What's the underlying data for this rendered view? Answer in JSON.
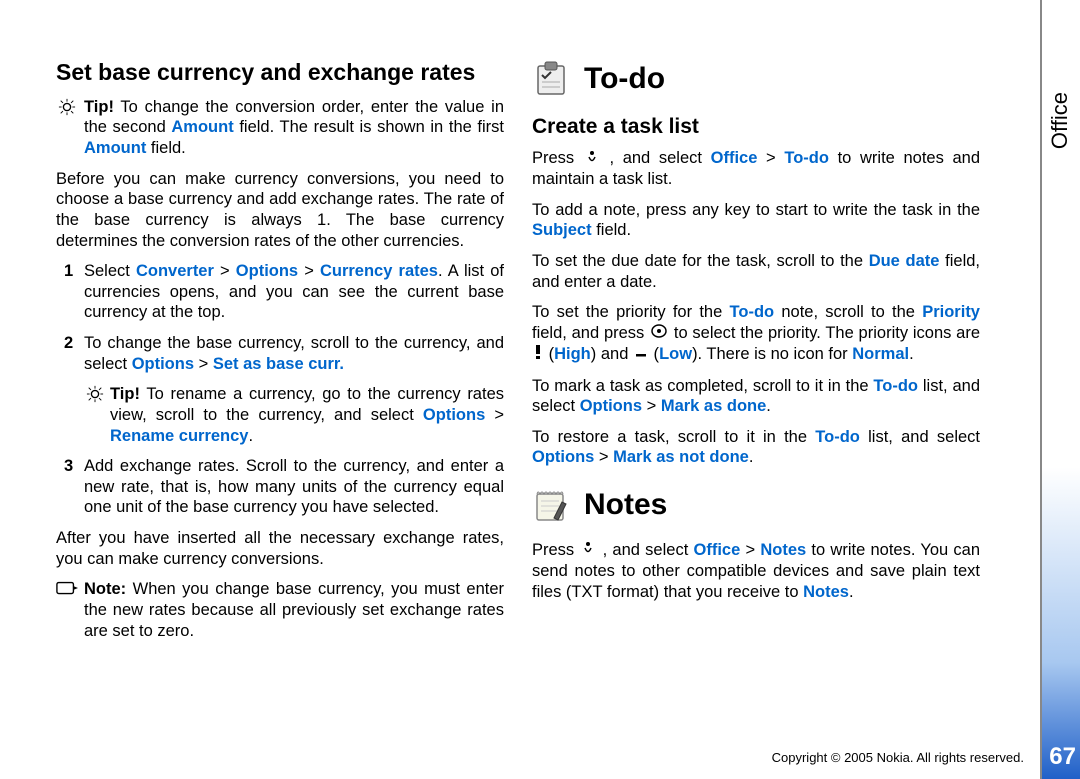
{
  "side_tab": "Office",
  "page_number": "67",
  "copyright": "Copyright © 2005 Nokia. All rights reserved.",
  "left": {
    "heading": "Set base currency and exchange rates",
    "tip1_label": "Tip!",
    "tip1_a": " To change the conversion order, enter the value in the second ",
    "tip1_amount1": "Amount",
    "tip1_b": " field. The result is shown in the first ",
    "tip1_amount2": "Amount",
    "tip1_c": " field.",
    "para1": "Before you can make currency conversions, you need to choose a base currency and add exchange rates. The rate of the base currency is always 1. The base currency determines the conversion rates of the other currencies.",
    "step1_a": "Select ",
    "step1_conv": "Converter",
    "step1_gt1": " > ",
    "step1_opt": "Options",
    "step1_gt2": " > ",
    "step1_cr": "Currency rates",
    "step1_b": ". A list of currencies opens, and you can see the current base currency at the top.",
    "step2_a": "To change the base currency, scroll to the currency, and select ",
    "step2_opt": "Options",
    "step2_gt": " > ",
    "step2_set": "Set as base curr.",
    "tip2_label": "Tip!",
    "tip2_a": " To rename a currency, go to the currency rates view, scroll to the currency, and select ",
    "tip2_opt": "Options",
    "tip2_gt": " > ",
    "tip2_ren": "Rename currency",
    "tip2_dot": ".",
    "step3": "Add exchange rates. Scroll to the currency, and enter a new rate, that is, how many units of the currency equal one unit of the base currency you have selected.",
    "para2": "After you have inserted all the necessary exchange rates, you can make currency conversions.",
    "note_label": "Note:",
    "note_text": " When you change base currency, you must enter the new rates because all previously set exchange rates are set to zero."
  },
  "right": {
    "todo_title": "To-do",
    "h3": "Create a task list",
    "p1_a": "Press ",
    "p1_b": " , and select ",
    "p1_office": "Office",
    "p1_gt": " > ",
    "p1_todo": "To-do",
    "p1_c": " to write notes and maintain a task list.",
    "p2_a": "To add a note, press any key to start to write the task in the ",
    "p2_subject": "Subject",
    "p2_b": " field.",
    "p3_a": "To set the due date for the task, scroll to the ",
    "p3_due": "Due date",
    "p3_b": " field, and enter a date.",
    "p4_a": "To set the priority for the ",
    "p4_todo1": "To-do",
    "p4_b": " note, scroll to the ",
    "p4_prio": "Priority",
    "p4_c": " field, and press ",
    "p4_d": " to select the priority. The priority icons are ",
    "p4_high": "High",
    "p4_e": ") and ",
    "p4_low": "Low",
    "p4_f": "). There is no icon for ",
    "p4_normal": "Normal",
    "p4_g": ".",
    "p5_a": "To mark a task as completed, scroll to it in the ",
    "p5_todo": "To-do",
    "p5_b": " list, and select ",
    "p5_opt": "Options",
    "p5_gt": " > ",
    "p5_mark": "Mark as done",
    "p5_dot": ".",
    "p6_a": "To restore a task, scroll to it in the ",
    "p6_todo": "To-do",
    "p6_b": " list, and select ",
    "p6_opt": "Options",
    "p6_gt": " > ",
    "p6_mark": "Mark as not done",
    "p6_dot": ".",
    "notes_title": "Notes",
    "p7_a": "Press ",
    "p7_b": " , and select ",
    "p7_office": "Office",
    "p7_gt": " > ",
    "p7_notes": "Notes",
    "p7_c": " to write notes. You can send notes to other compatible devices and save plain text files (TXT format) that you receive to ",
    "p7_notes2": "Notes",
    "p7_dot": "."
  }
}
